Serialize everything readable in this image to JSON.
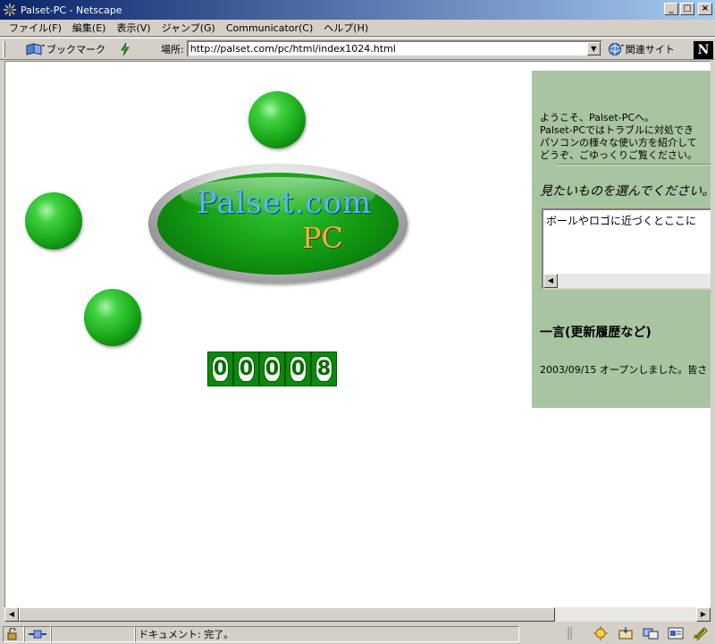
{
  "window": {
    "title": "Palset-PC - Netscape"
  },
  "menu": [
    "ファイル(F)",
    "編集(E)",
    "表示(V)",
    "ジャンプ(G)",
    "Communicator(C)",
    "ヘルプ(H)"
  ],
  "toolbar": {
    "bookmarks_label": "ブックマーク",
    "location_label": "場所:",
    "url": "http://palset.com/pc/html/index1024.html",
    "related_label": "関連サイト",
    "netscape_logo": "N"
  },
  "page": {
    "logo_line1": "Palset.com",
    "logo_line2": "PC",
    "counter_digits": [
      "0",
      "0",
      "0",
      "0",
      "8"
    ],
    "welcome_lines": [
      "ようこそ、Palset-PCへ。",
      "Palset-PCではトラブルに対処でき",
      "パソコンの様々な使い方を紹介して",
      "どうぞ、ごゆっくりご覧ください。"
    ],
    "choose_heading": "見たいものを選んでください。",
    "message_box_text": "ボールやロゴに近づくとここに",
    "hitokoto_heading": "一言(更新履歴など)",
    "news_line": "2003/09/15 オープンしました。皆さ"
  },
  "status": {
    "text": "ドキュメント: 完了。"
  },
  "colors": {
    "panel_bg": "#a8c4a0",
    "ball_green": "#1aaa1a",
    "title_blue": "#0a246a"
  }
}
